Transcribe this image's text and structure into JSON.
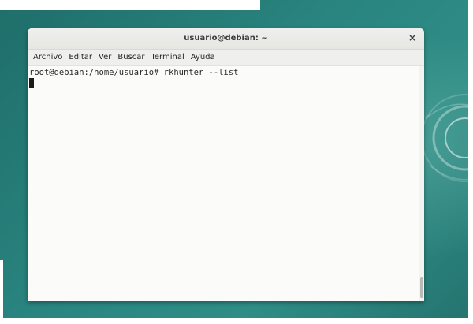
{
  "window": {
    "title": "usuario@debian: ~",
    "close_glyph": "×"
  },
  "menubar": {
    "items": [
      {
        "label": "Archivo"
      },
      {
        "label": "Editar"
      },
      {
        "label": "Ver"
      },
      {
        "label": "Buscar"
      },
      {
        "label": "Terminal"
      },
      {
        "label": "Ayuda"
      }
    ]
  },
  "terminal": {
    "lines": [
      "root@debian:/home/usuario# rkhunter --list"
    ]
  },
  "icons": {
    "close": "close-icon",
    "cursor": "block-cursor"
  }
}
